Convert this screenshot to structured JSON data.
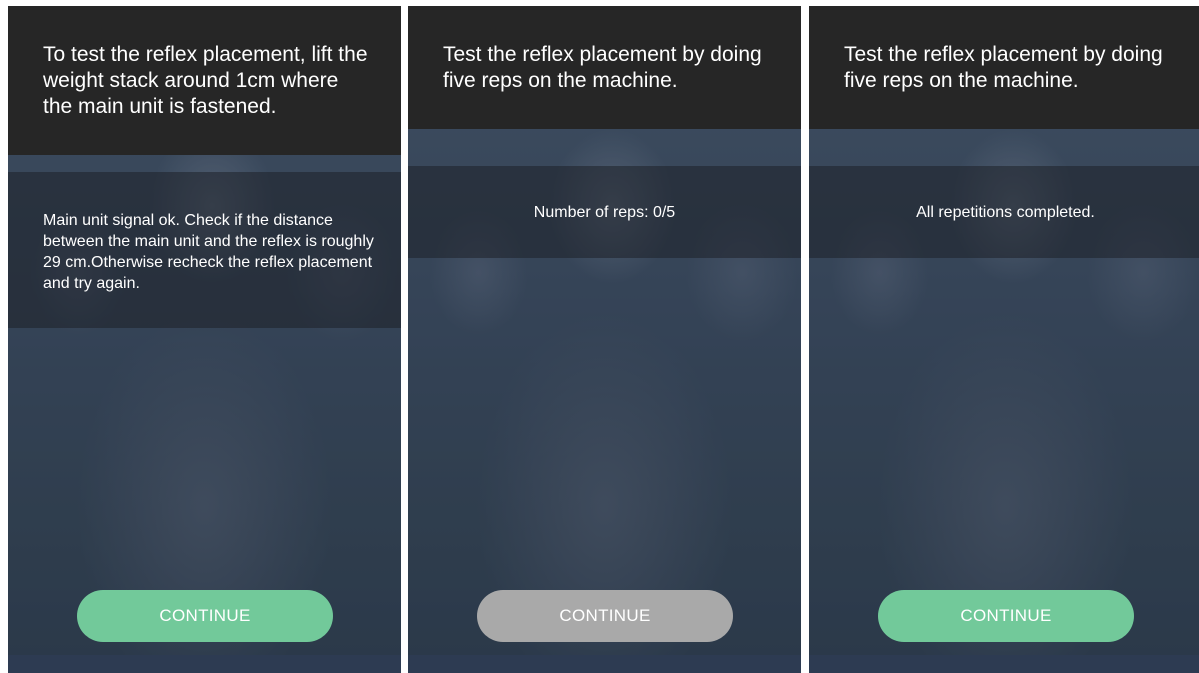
{
  "screens": [
    {
      "header": "To test the reflex placement, lift the weight stack around 1cm where the main unit is fastened.",
      "message": "Main unit signal ok. Check if the distance between the main unit and the reflex is roughly 29 cm.Otherwise recheck the reflex placement and try again.",
      "button_label": "CONTINUE",
      "button_state": "enabled"
    },
    {
      "header": "Test the reflex placement by doing five reps on the machine.",
      "message": "Number of reps: 0/5",
      "button_label": "CONTINUE",
      "button_state": "disabled"
    },
    {
      "header": "Test the reflex placement by doing five reps on the machine.",
      "message": "All repetitions completed.",
      "button_label": "CONTINUE",
      "button_state": "enabled"
    }
  ],
  "colors": {
    "header_bg": "#262626",
    "button_enabled": "#72c99a",
    "button_disabled": "#a9a9a9"
  }
}
